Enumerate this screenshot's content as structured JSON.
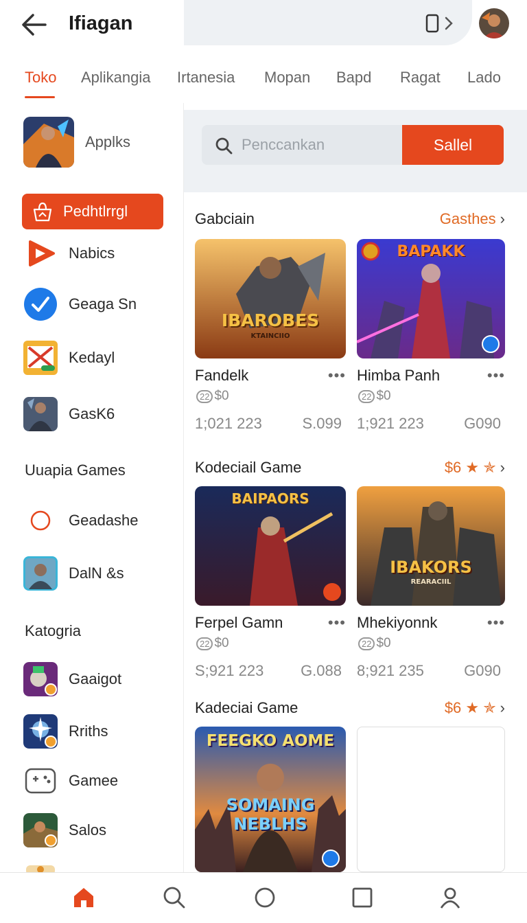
{
  "header": {
    "title": "Ifiagan",
    "back_icon": "arrow-left-icon",
    "device_icon": "phone-chevron-icon"
  },
  "tabs": [
    "Toko",
    "Aplikangia",
    "Irtanesia",
    "Mopan",
    "Bapd",
    "Ragat",
    "Lado"
  ],
  "sidebar": {
    "top_item": "Applks",
    "active_item": "Pedhtlrrgl",
    "items": [
      "Nabics",
      "Geaga Sn",
      "Kedayl",
      "GasK6"
    ],
    "section1_title": "Uuapia Games",
    "section1_items": [
      "Geadashe",
      "DalN &s"
    ],
    "section2_title": "Katogria",
    "section2_items": [
      "Gaaigot",
      "Rriths",
      "Gamee",
      "Salos"
    ]
  },
  "search": {
    "placeholder": "Penccankan",
    "button_label": "Sallel"
  },
  "sections": [
    {
      "title": "Gabciain",
      "more": "Gasthes",
      "cards": [
        {
          "name": "Fandelk",
          "image_text": "IBAROBES",
          "image_sub": "KTAINCIIO",
          "count": "1;021 223",
          "price": "S.099"
        },
        {
          "name": "Himba Panh",
          "image_text": "BAPAKK",
          "image_sub": "",
          "count": "1;921 223",
          "price": "G090"
        }
      ]
    },
    {
      "title": "Kodeciail Game",
      "more": "$6 ★ ✯",
      "cards": [
        {
          "name": "Ferpel Gamn",
          "image_text": "BAIPAORS",
          "image_sub": "",
          "count": "S;921 223",
          "price": "G.088"
        },
        {
          "name": "Mhekiyonnk",
          "image_text": "IBAKORS",
          "image_sub": "REARACIIL",
          "count": "8;921 235",
          "price": "G090"
        }
      ]
    },
    {
      "title": "Kadeciai Game",
      "more": "$6 ★ ✯",
      "cards": [
        {
          "name": "",
          "image_text": "FEEGKO AOME",
          "image_sub": "SOMAING NEBLHS",
          "count": "",
          "price": ""
        }
      ]
    }
  ],
  "price_tag": {
    "pill": "22",
    "symbol": "$0"
  },
  "more_dots": "•••",
  "accent_color": "#e5481e",
  "bottom_nav": [
    "home-icon",
    "search-icon",
    "circle-icon",
    "square-icon",
    "profile-icon"
  ]
}
